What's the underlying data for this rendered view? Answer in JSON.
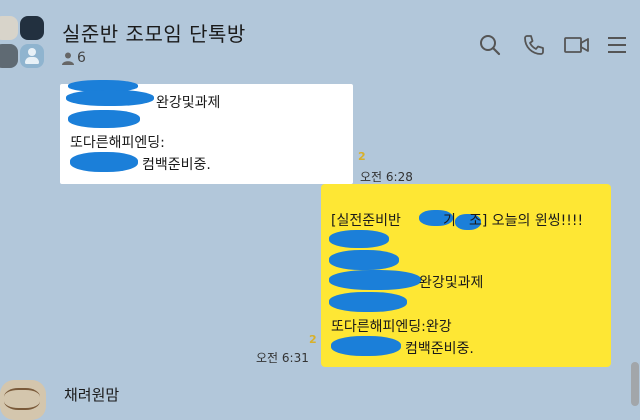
{
  "header": {
    "title": "실준반 조모임 단톡방",
    "member_count": "6",
    "icons": [
      "search-icon",
      "call-icon",
      "video-call-icon",
      "menu-icon"
    ]
  },
  "messages": {
    "incoming": {
      "line1": "완강및과제",
      "line2": "또다른해피엔딩:",
      "line3": "컴백준비중.",
      "unread": "2",
      "time": "오전 6:28"
    },
    "outgoing": {
      "line1_a": "[실전준비반",
      "line1_b": "기",
      "line1_c": "조] 오늘의 윈씽!!!!",
      "line3": "완강및과제",
      "line5": "또다른해피엔딩:완강",
      "line6": "컴백준비중.",
      "unread": "2",
      "time": "오전 6:31"
    },
    "next": {
      "sender": "채려원맘"
    }
  },
  "colors": {
    "background": "#b2c7da",
    "my_bubble": "#fee734",
    "other_bubble": "#ffffff",
    "redaction": "#1b7fd9",
    "unread": "#d8b02a"
  }
}
